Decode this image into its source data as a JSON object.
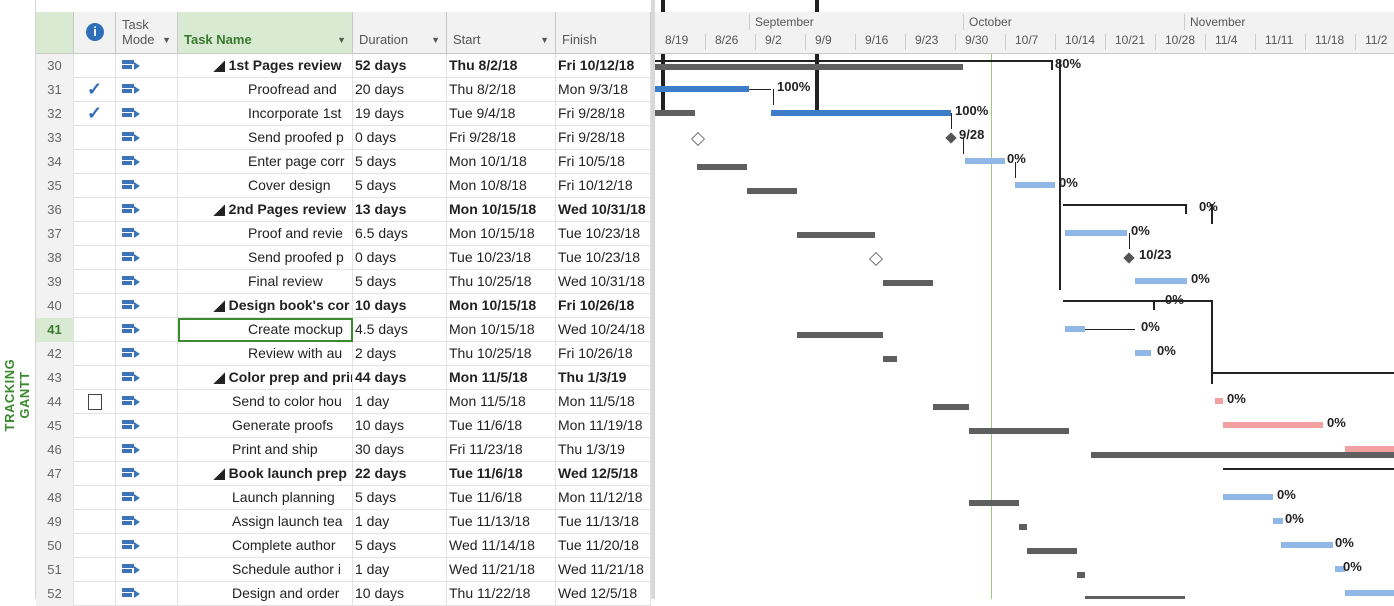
{
  "view_label": "TRACKING GANTT",
  "columns": {
    "info_icon": "i",
    "task_mode": "Task Mode",
    "task_name": "Task Name",
    "duration": "Duration",
    "start": "Start",
    "finish": "Finish"
  },
  "timeline": {
    "months": [
      "September",
      "October",
      "November"
    ],
    "weeks": [
      "8/19",
      "8/26",
      "9/2",
      "9/9",
      "9/16",
      "9/23",
      "9/30",
      "10/7",
      "10/14",
      "10/21",
      "10/28",
      "11/4",
      "11/11",
      "11/18",
      "11/2"
    ]
  },
  "tasks": [
    {
      "id": "30",
      "name": "◢ 1st Pages review",
      "duration": "52 days",
      "start": "Thu 8/2/18",
      "finish": "Fri 10/12/18",
      "summary": true,
      "done": false
    },
    {
      "id": "31",
      "name": "Proofread and",
      "duration": "20 days",
      "start": "Thu 8/2/18",
      "finish": "Mon 9/3/18",
      "summary": false,
      "done": true
    },
    {
      "id": "32",
      "name": "Incorporate 1st",
      "duration": "19 days",
      "start": "Tue 9/4/18",
      "finish": "Fri 9/28/18",
      "summary": false,
      "done": true
    },
    {
      "id": "33",
      "name": "Send proofed p",
      "duration": "0 days",
      "start": "Fri 9/28/18",
      "finish": "Fri 9/28/18",
      "summary": false,
      "done": false
    },
    {
      "id": "34",
      "name": "Enter page corr",
      "duration": "5 days",
      "start": "Mon 10/1/18",
      "finish": "Fri 10/5/18",
      "summary": false,
      "done": false
    },
    {
      "id": "35",
      "name": "Cover design",
      "duration": "5 days",
      "start": "Mon 10/8/18",
      "finish": "Fri 10/12/18",
      "summary": false,
      "done": false
    },
    {
      "id": "36",
      "name": "◢ 2nd Pages review",
      "duration": "13 days",
      "start": "Mon 10/15/18",
      "finish": "Wed 10/31/18",
      "summary": true,
      "done": false
    },
    {
      "id": "37",
      "name": "Proof and revie",
      "duration": "6.5 days",
      "start": "Mon 10/15/18",
      "finish": "Tue 10/23/18",
      "summary": false,
      "done": false
    },
    {
      "id": "38",
      "name": "Send proofed p",
      "duration": "0 days",
      "start": "Tue 10/23/18",
      "finish": "Tue 10/23/18",
      "summary": false,
      "done": false
    },
    {
      "id": "39",
      "name": "Final review",
      "duration": "5 days",
      "start": "Thu 10/25/18",
      "finish": "Wed 10/31/18",
      "summary": false,
      "done": false
    },
    {
      "id": "40",
      "name": "◢ Design book's cor",
      "duration": "10 days",
      "start": "Mon 10/15/18",
      "finish": "Fri 10/26/18",
      "summary": true,
      "done": false
    },
    {
      "id": "41",
      "name": "Create mockup",
      "duration": "4.5 days",
      "start": "Mon 10/15/18",
      "finish": "Wed 10/24/18",
      "summary": false,
      "done": false
    },
    {
      "id": "42",
      "name": "Review with au",
      "duration": "2 days",
      "start": "Thu 10/25/18",
      "finish": "Fri 10/26/18",
      "summary": false,
      "done": false
    },
    {
      "id": "43",
      "name": "◢ Color prep and print",
      "duration": "44 days",
      "start": "Mon 11/5/18",
      "finish": "Thu 1/3/19",
      "summary": true,
      "done": false
    },
    {
      "id": "44",
      "name": "Send to color hou",
      "duration": "1 day",
      "start": "Mon 11/5/18",
      "finish": "Mon 11/5/18",
      "summary": false,
      "done": false
    },
    {
      "id": "45",
      "name": "Generate proofs",
      "duration": "10 days",
      "start": "Tue 11/6/18",
      "finish": "Mon 11/19/18",
      "summary": false,
      "done": false
    },
    {
      "id": "46",
      "name": "Print and ship",
      "duration": "30 days",
      "start": "Fri 11/23/18",
      "finish": "Thu 1/3/19",
      "summary": false,
      "done": false
    },
    {
      "id": "47",
      "name": "◢ Book launch prep",
      "duration": "22 days",
      "start": "Tue 11/6/18",
      "finish": "Wed 12/5/18",
      "summary": true,
      "done": false
    },
    {
      "id": "48",
      "name": "Launch planning",
      "duration": "5 days",
      "start": "Tue 11/6/18",
      "finish": "Mon 11/12/18",
      "summary": false,
      "done": false
    },
    {
      "id": "49",
      "name": "Assign launch tea",
      "duration": "1 day",
      "start": "Tue 11/13/18",
      "finish": "Tue 11/13/18",
      "summary": false,
      "done": false
    },
    {
      "id": "50",
      "name": "Complete author",
      "duration": "5 days",
      "start": "Wed 11/14/18",
      "finish": "Tue 11/20/18",
      "summary": false,
      "done": false
    },
    {
      "id": "51",
      "name": "Schedule author i",
      "duration": "1 day",
      "start": "Wed 11/21/18",
      "finish": "Wed 11/21/18",
      "summary": false,
      "done": false
    },
    {
      "id": "52",
      "name": "Design and order",
      "duration": "10 days",
      "start": "Thu 11/22/18",
      "finish": "Wed 12/5/18",
      "summary": false,
      "done": false
    }
  ],
  "chart_labels": {
    "l30": "80%",
    "l31": "100%",
    "l32": "100%",
    "l33": "9/28",
    "l34": "0%",
    "l35": "0%",
    "l36": "0%",
    "l37": "0%",
    "l38": "10/23",
    "l39": "0%",
    "l40": "0%",
    "l41": "0%",
    "l42": "0%",
    "l44": "0%",
    "l45": "0%",
    "l48": "0%",
    "l49": "0%",
    "l50": "0%",
    "l51": "0%"
  },
  "checkmark": "✓",
  "colors": {
    "accent": "#3a8a2e",
    "progress": "#3d7dc8",
    "remaining": "#8fb8e6",
    "critical": "#f2a0a0",
    "baseline": "#5f5f5f"
  }
}
